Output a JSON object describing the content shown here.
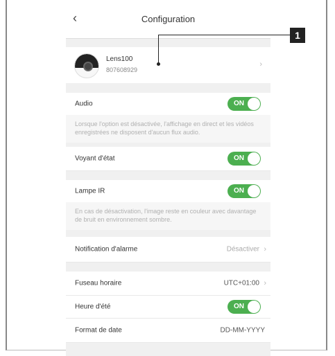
{
  "header": {
    "back_icon": "chevron-left-icon",
    "title": "Configuration"
  },
  "device": {
    "name": "Lens100",
    "serial": "807608929"
  },
  "callout": {
    "label": "1"
  },
  "settings": {
    "audio": {
      "label": "Audio",
      "toggle": "ON",
      "description": "Lorsque l'option est désactivée, l'affichage en direct et les vidéos enregistrées ne disposent d'aucun flux audio."
    },
    "status_light": {
      "label": "Voyant d'état",
      "toggle": "ON"
    },
    "ir_lamp": {
      "label": "Lampe IR",
      "toggle": "ON",
      "description": "En cas de désactivation, l'image reste en couleur avec davantage de bruit en environnement sombre."
    },
    "alarm_notification": {
      "label": "Notification d'alarme",
      "value": "Désactiver"
    },
    "timezone": {
      "label": "Fuseau horaire",
      "value": "UTC+01:00"
    },
    "daylight_saving": {
      "label": "Heure d'été",
      "toggle": "ON"
    },
    "date_format": {
      "label": "Format de date",
      "value": "DD-MM-YYYY"
    }
  },
  "colors": {
    "toggle_on": "#4caf50",
    "background": "#f0f0f0"
  }
}
